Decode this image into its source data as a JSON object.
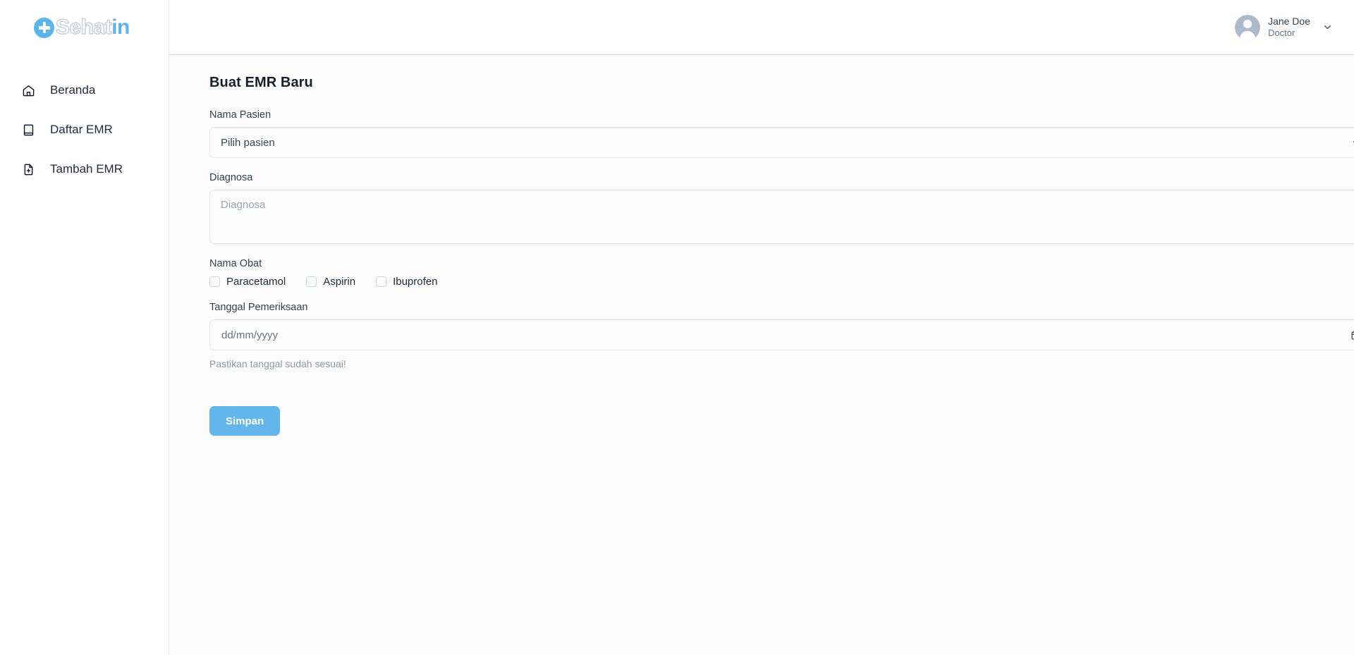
{
  "brand": {
    "name_light": "Sehat",
    "name_accent": "in",
    "accent_color": "#5bb4ea",
    "mark_icon": "plus-circle-icon"
  },
  "sidebar": {
    "items": [
      {
        "label": "Beranda",
        "icon": "home-icon"
      },
      {
        "label": "Daftar EMR",
        "icon": "book-icon"
      },
      {
        "label": "Tambah EMR",
        "icon": "file-plus-icon"
      }
    ]
  },
  "topbar": {
    "user": {
      "name": "Jane Doe",
      "role": "Doctor",
      "avatar_icon": "user-avatar-icon",
      "caret_icon": "chevron-down-icon"
    }
  },
  "page": {
    "title": "Buat EMR Baru"
  },
  "form": {
    "patient": {
      "label": "Nama Pasien",
      "selected": "Pilih pasien",
      "options": [
        "Pilih pasien"
      ],
      "caret_icon": "chevron-down-icon"
    },
    "diagnosis": {
      "label": "Diagnosa",
      "placeholder": "Diagnosa",
      "value": ""
    },
    "medicine": {
      "label": "Nama Obat",
      "options": [
        {
          "label": "Paracetamol",
          "checked": false
        },
        {
          "label": "Aspirin",
          "checked": false
        },
        {
          "label": "Ibuprofen",
          "checked": false
        }
      ]
    },
    "exam_date": {
      "label": "Tanggal Pemeriksaan",
      "placeholder": "dd/mm/yyyy",
      "value": "",
      "icon": "calendar-icon",
      "help_text": "Pastikan tanggal sudah sesuai!"
    },
    "submit": {
      "label": "Simpan",
      "color": "#62b6ec"
    }
  }
}
